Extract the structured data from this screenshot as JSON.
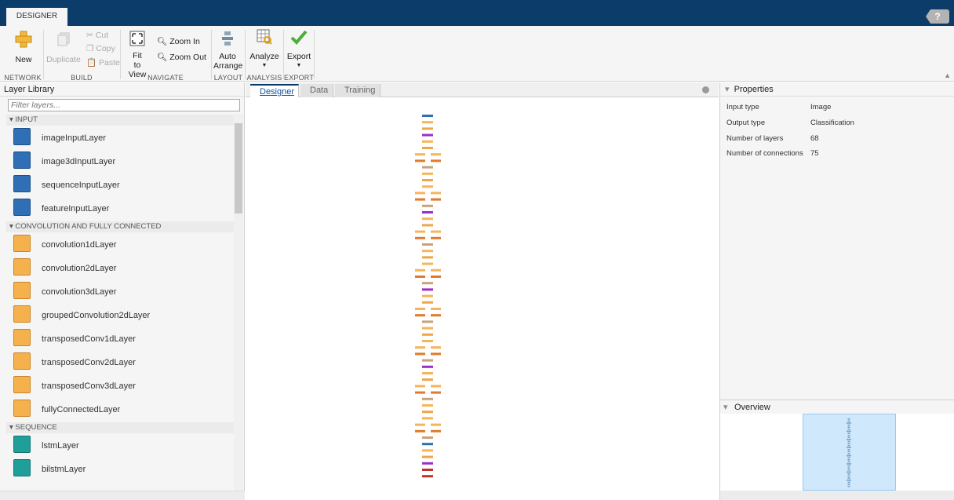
{
  "window": {
    "tab_label": "DESIGNER",
    "help_icon": "help-icon"
  },
  "toolstrip": {
    "new_label": "New",
    "duplicate_label": "Duplicate",
    "cut_label": "Cut",
    "copy_label": "Copy",
    "paste_label": "Paste",
    "fit_label_1": "Fit",
    "fit_label_2": "to View",
    "zoom_in_label": "Zoom In",
    "zoom_out_label": "Zoom Out",
    "auto_label_1": "Auto",
    "auto_label_2": "Arrange",
    "analyze_label": "Analyze",
    "export_label": "Export",
    "sections": {
      "network": "NETWORK",
      "build": "BUILD",
      "navigate": "NAVIGATE",
      "layout": "LAYOUT",
      "analysis": "ANALYSIS",
      "export": "EXPORT"
    }
  },
  "library": {
    "title": "Layer Library",
    "filter_placeholder": "Filter layers...",
    "categories": {
      "input": "INPUT",
      "conv": "CONVOLUTION AND FULLY CONNECTED",
      "sequence": "SEQUENCE"
    },
    "input_items": [
      "imageInputLayer",
      "image3dInputLayer",
      "sequenceInputLayer",
      "featureInputLayer"
    ],
    "conv_items": [
      "convolution1dLayer",
      "convolution2dLayer",
      "convolution3dLayer",
      "groupedConvolution2dLayer",
      "transposedConv1dLayer",
      "transposedConv2dLayer",
      "transposedConv3dLayer",
      "fullyConnectedLayer"
    ],
    "sequence_items": [
      "lstmLayer",
      "bilstmLayer"
    ]
  },
  "canvas": {
    "tabs": [
      "Designer",
      "Data",
      "Training"
    ],
    "layer_colors": {
      "input": "#2f6fb5",
      "conv": "#f5b55a",
      "batchnorm": "#f0a548",
      "relu": "#e07b2c",
      "pool": "#c9a27c",
      "activation": "#9b2fc8",
      "output": "#c0342b",
      "fc": "#c67a66"
    }
  },
  "properties": {
    "title": "Properties",
    "rows": [
      {
        "key": "Input type",
        "value": "Image"
      },
      {
        "key": "Output type",
        "value": "Classification"
      },
      {
        "key": "Number of layers",
        "value": "68"
      },
      {
        "key": "Number of connections",
        "value": "75"
      }
    ]
  },
  "overview": {
    "title": "Overview"
  }
}
